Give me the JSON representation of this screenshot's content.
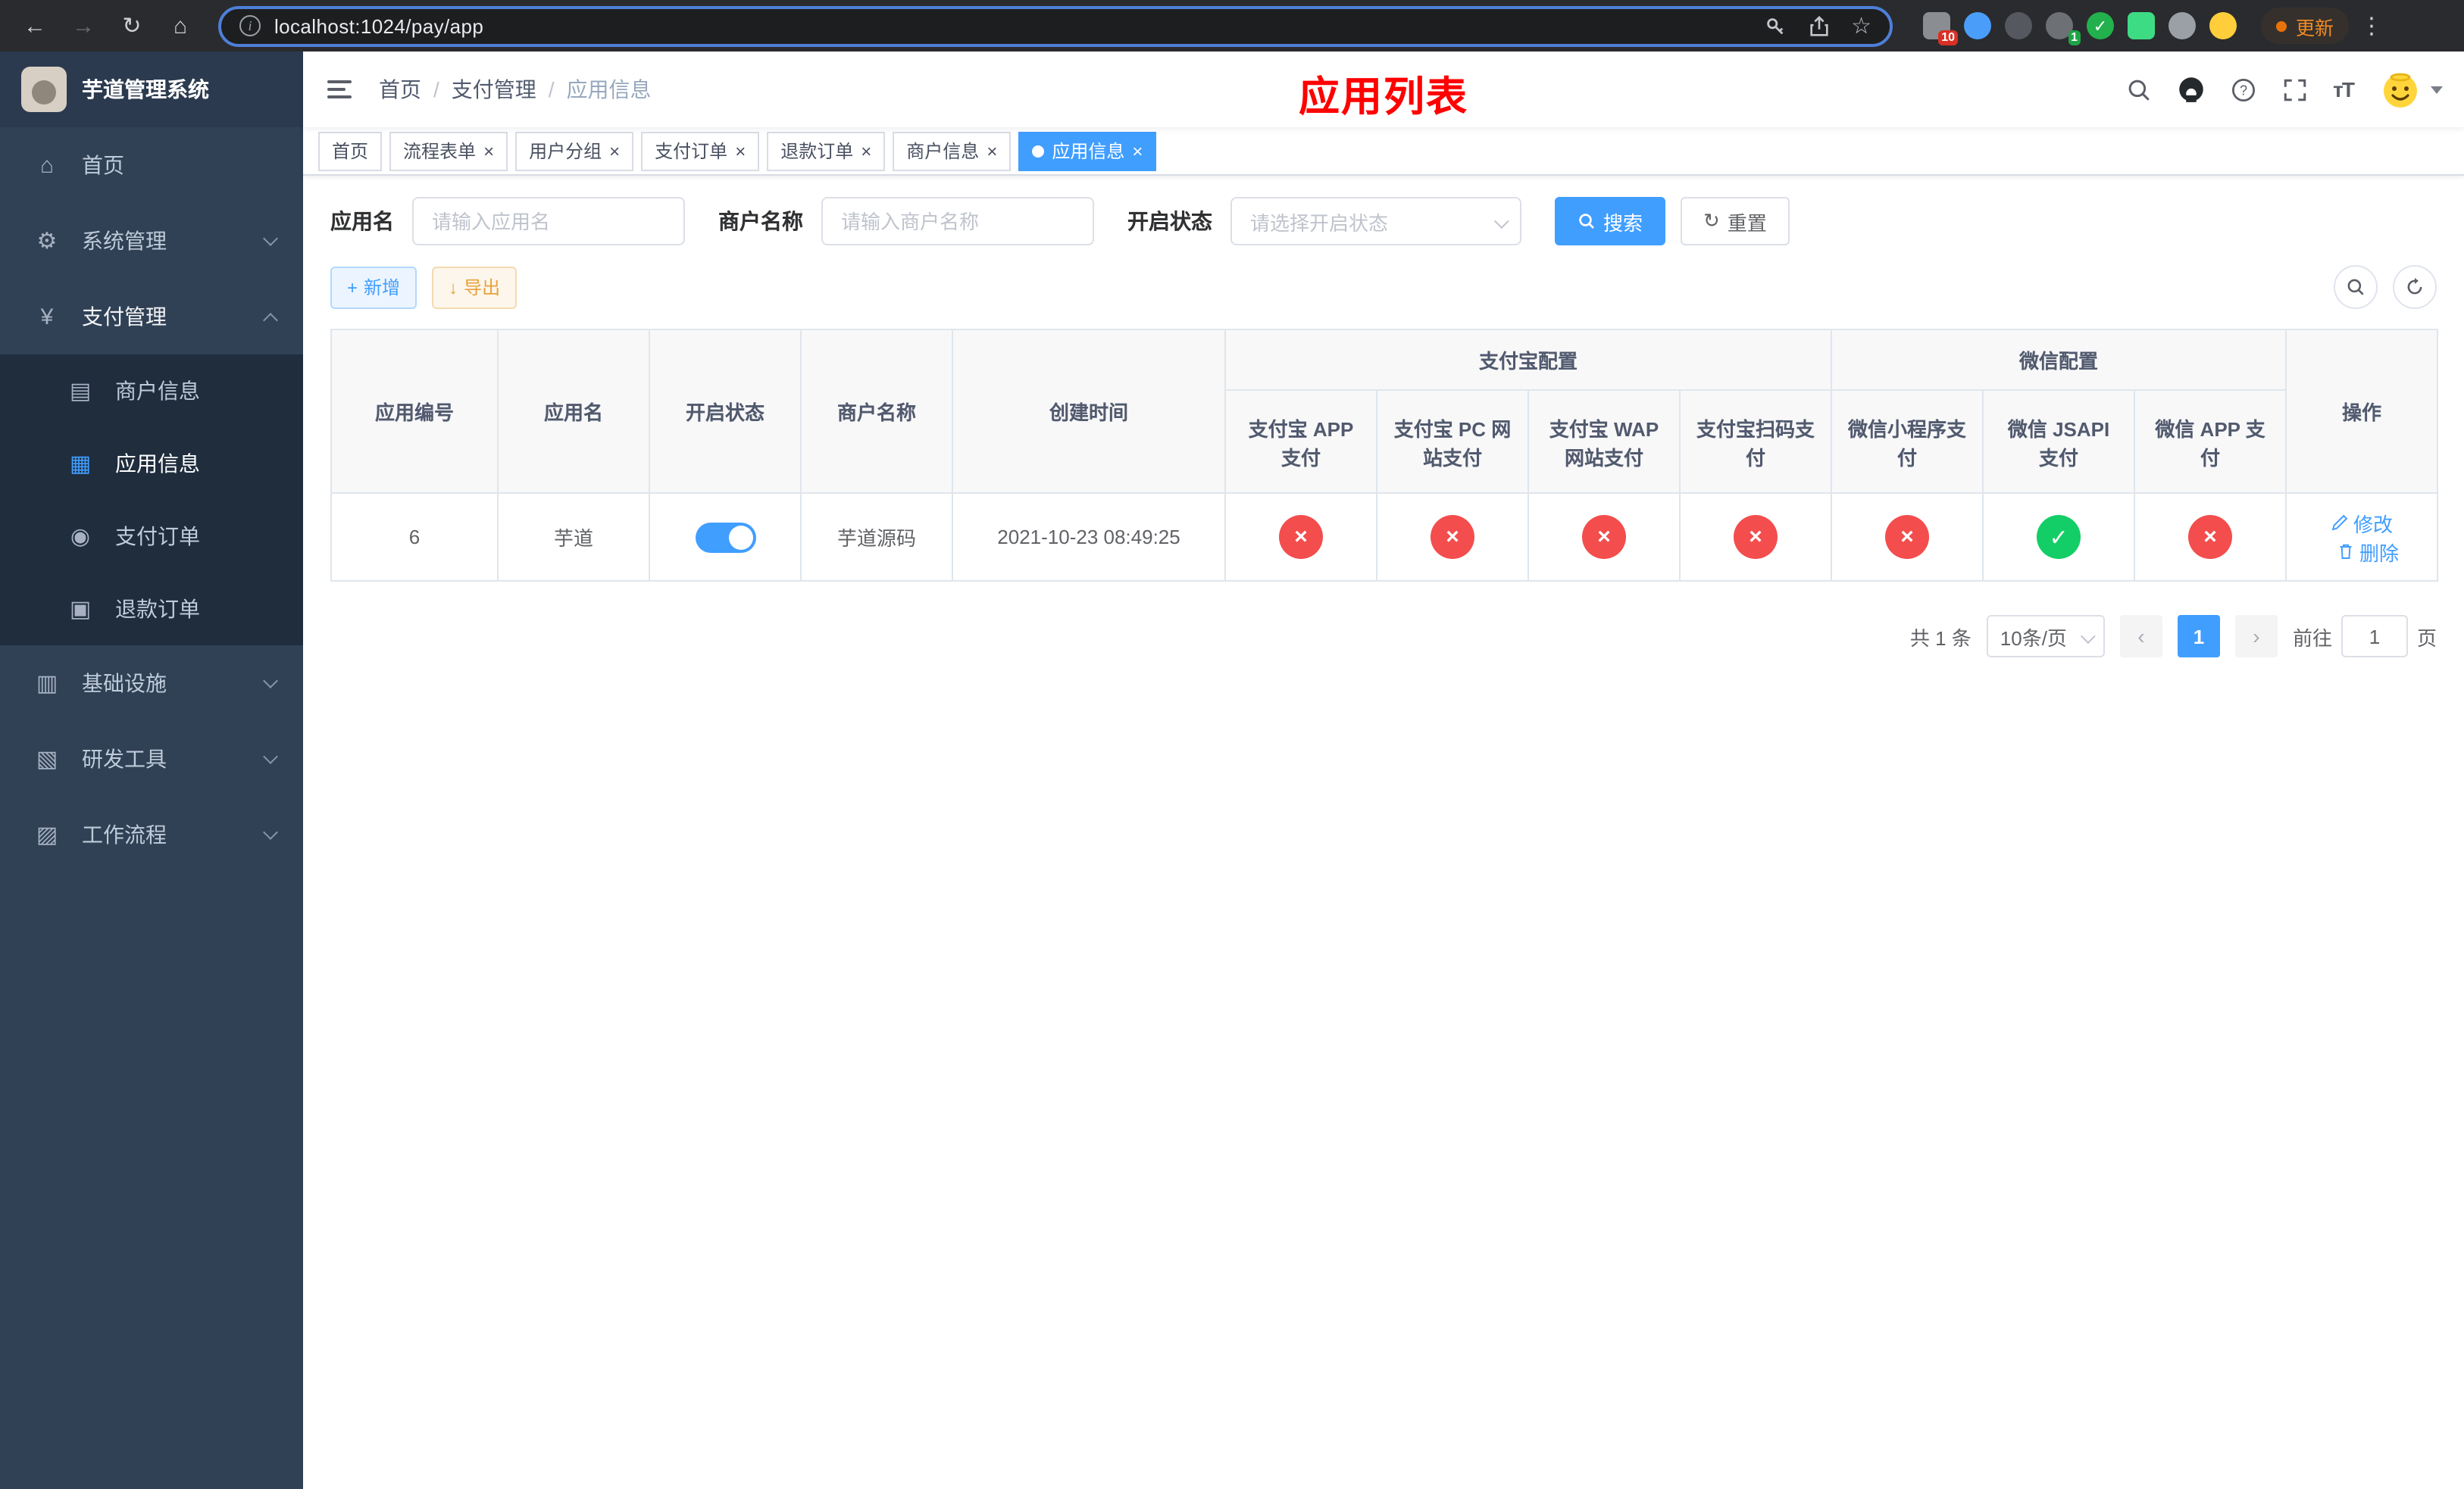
{
  "colors": {
    "primary": "#409EFF",
    "success": "#13ce66",
    "danger": "#f34d4d",
    "title_red": "#ff0000",
    "sidebar_bg": "#304156",
    "submenu_bg": "#1f2d3d"
  },
  "icons": {
    "back": "←",
    "forward": "→",
    "reload": "↻",
    "home": "⌂",
    "star": "☆",
    "kebab": "⋮",
    "info": "i",
    "close": "×",
    "check": "✓",
    "cross": "×",
    "plus": "+",
    "download": "↓",
    "reset": "↻",
    "prev": "‹",
    "next": "›"
  },
  "browser": {
    "url": "localhost:1024/pay/app",
    "update_label": "更新",
    "ext_badges": {
      "puzzle": "10",
      "profile": "1"
    }
  },
  "sidebar": {
    "title": "芋道管理系统",
    "items": [
      {
        "label": "首页",
        "icon": "⌂"
      },
      {
        "label": "系统管理",
        "icon": "⚙"
      },
      {
        "label": "支付管理",
        "icon": "¥"
      },
      {
        "label": "商户信息",
        "icon": "▤"
      },
      {
        "label": "应用信息",
        "icon": "▦"
      },
      {
        "label": "支付订单",
        "icon": "◉"
      },
      {
        "label": "退款订单",
        "icon": "▣"
      },
      {
        "label": "基础设施",
        "icon": "▥"
      },
      {
        "label": "研发工具",
        "icon": "▧"
      },
      {
        "label": "工作流程",
        "icon": "▨"
      }
    ]
  },
  "header": {
    "breadcrumb": [
      "首页",
      "支付管理",
      "应用信息"
    ],
    "page_title": "应用列表",
    "font_icon": "тT"
  },
  "tabs": [
    {
      "label": "首页"
    },
    {
      "label": "流程表单"
    },
    {
      "label": "用户分组"
    },
    {
      "label": "支付订单"
    },
    {
      "label": "退款订单"
    },
    {
      "label": "商户信息"
    },
    {
      "label": "应用信息"
    }
  ],
  "filters": {
    "app_name_label": "应用名",
    "app_name_placeholder": "请输入应用名",
    "merchant_label": "商户名称",
    "merchant_placeholder": "请输入商户名称",
    "status_label": "开启状态",
    "status_placeholder": "请选择开启状态",
    "search_label": "搜索",
    "reset_label": "重置"
  },
  "toolbar": {
    "add_label": "新增",
    "export_label": "导出"
  },
  "table": {
    "columns": {
      "app_id": "应用编号",
      "app_name": "应用名",
      "status": "开启状态",
      "merchant": "商户名称",
      "created": "创建时间",
      "alipay_group": "支付宝配置",
      "wechat_group": "微信配置",
      "alipay_app": "支付宝 APP 支付",
      "alipay_pc": "支付宝 PC 网站支付",
      "alipay_wap": "支付宝 WAP 网站支付",
      "alipay_qr": "支付宝扫码支付",
      "wechat_mini": "微信小程序支付",
      "wechat_jsapi": "微信 JSAPI 支付",
      "wechat_app": "微信 APP 支付",
      "ops": "操作"
    },
    "rows": [
      {
        "app_id": "6",
        "app_name": "芋道",
        "enabled": true,
        "merchant": "芋道源码",
        "created": "2021-10-23 08:49:25",
        "configs": [
          false,
          false,
          false,
          false,
          false,
          true,
          false
        ],
        "edit_label": "修改",
        "delete_label": "删除"
      }
    ]
  },
  "pagination": {
    "total": "共 1 条",
    "page_size": "10条/页",
    "current_page": "1",
    "goto_label": "前往",
    "goto_value": "1",
    "page_suffix": "页"
  }
}
